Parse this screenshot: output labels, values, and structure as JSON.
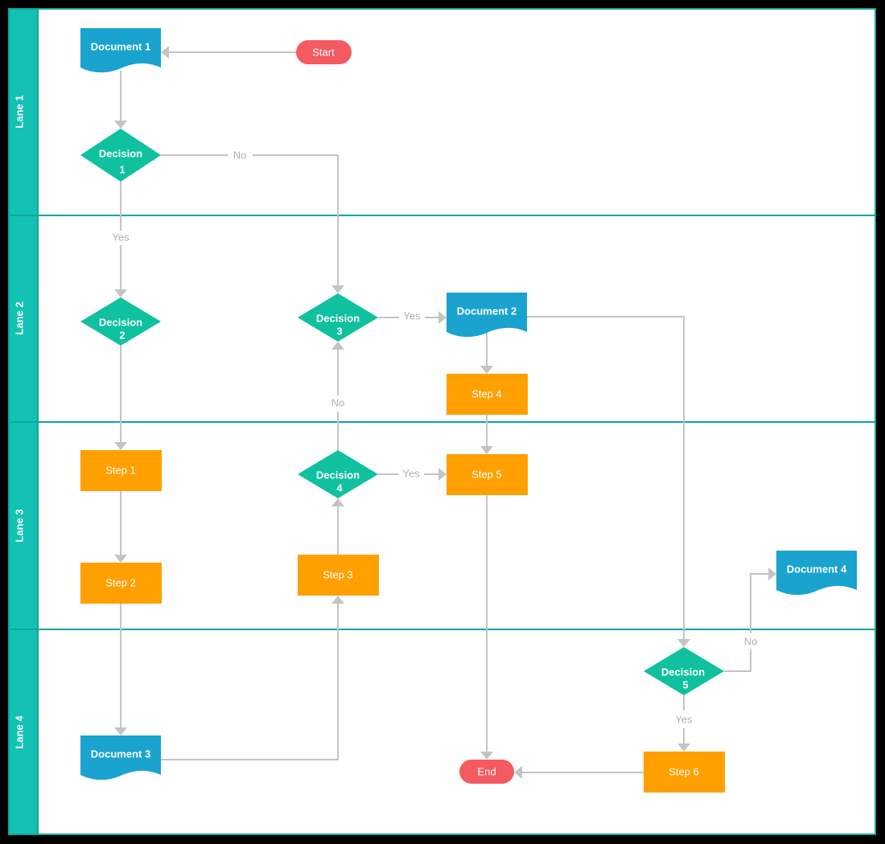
{
  "colors": {
    "lane_header": "#14c1b5",
    "lane_border": "#0aa89e",
    "document": "#1aa3cf",
    "decision": "#0fc19e",
    "process": "#ffa000",
    "terminator": "#f45a60",
    "connector": "#c4c4c4",
    "connector_label": "#b0b0b0"
  },
  "lanes": [
    "Lane 1",
    "Lane 2",
    "Lane 3",
    "Lane 4"
  ],
  "nodes": {
    "start": "Start",
    "end": "End",
    "document1": "Document 1",
    "document2": "Document 2",
    "document3": "Document 3",
    "document4": "Document 4",
    "decision1": [
      "Decision",
      "1"
    ],
    "decision2": [
      "Decision",
      "2"
    ],
    "decision3": [
      "Decision",
      "3"
    ],
    "decision4": [
      "Decision",
      "4"
    ],
    "decision5": [
      "Decision",
      "5"
    ],
    "step1": "Step 1",
    "step2": "Step 2",
    "step3": "Step 3",
    "step4": "Step 4",
    "step5": "Step 5",
    "step6": "Step 6"
  },
  "edge_labels": {
    "d1_no": "No",
    "d1_yes": "Yes",
    "d3_yes": "Yes",
    "d4_no": "No",
    "d4_yes": "Yes",
    "d5_no": "No",
    "d5_yes": "Yes"
  }
}
